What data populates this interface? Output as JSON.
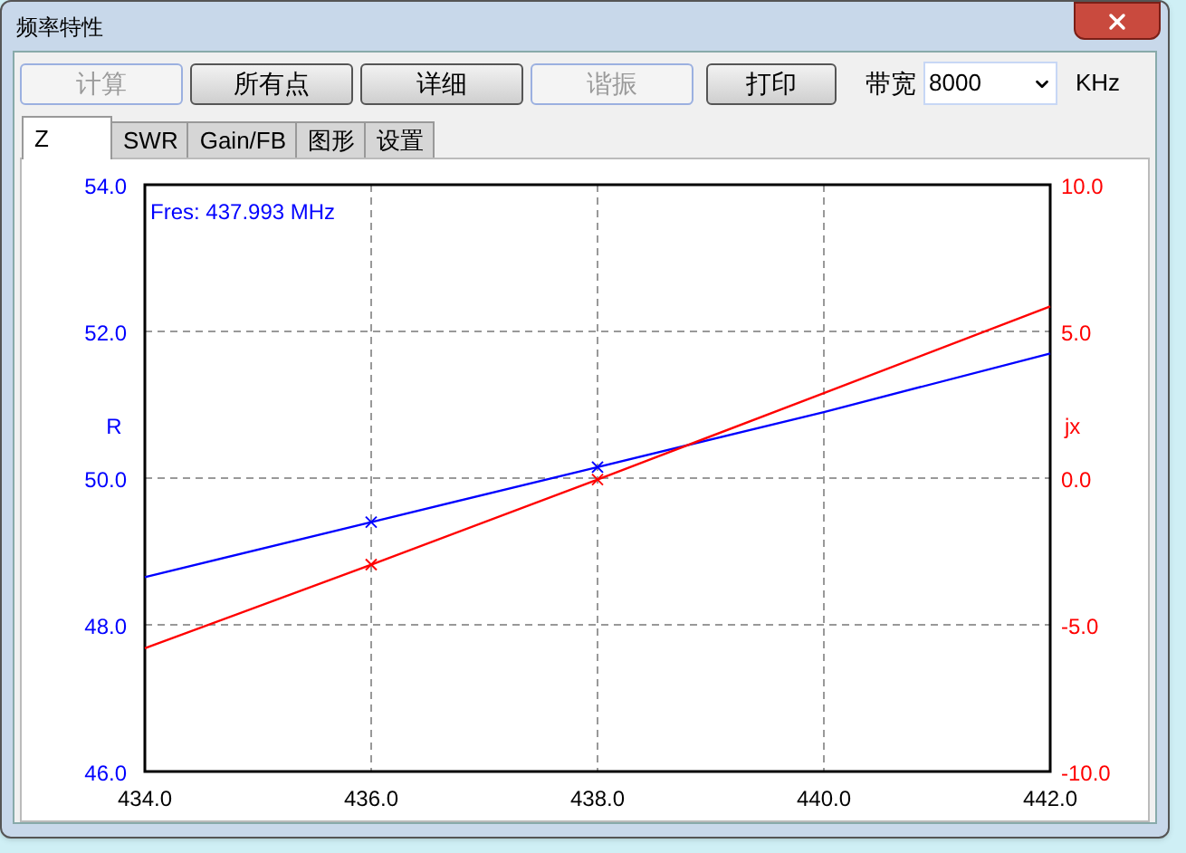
{
  "window": {
    "title": "频率特性"
  },
  "toolbar": {
    "buttons": [
      {
        "label": "计算",
        "disabled": true
      },
      {
        "label": "所有点",
        "disabled": false
      },
      {
        "label": "详细",
        "disabled": false
      },
      {
        "label": "谐振",
        "disabled": true
      },
      {
        "label": "打印",
        "disabled": false
      }
    ],
    "bandwidth": {
      "label": "带宽",
      "value": "8000",
      "unit": "KHz"
    }
  },
  "tabs": [
    {
      "label": "Z",
      "selected": true
    },
    {
      "label": "SWR",
      "selected": false
    },
    {
      "label": "Gain/FB",
      "selected": false
    },
    {
      "label": "图形",
      "selected": false
    },
    {
      "label": "设置",
      "selected": false
    }
  ],
  "chart": {
    "resonance_label": "Fres: 437.993 MHz",
    "point_markers": [
      {
        "marked": false
      },
      {
        "marked": true
      },
      {
        "marked": true
      },
      {
        "marked": false
      },
      {
        "marked": false
      }
    ],
    "chart_data": {
      "type": "line",
      "grid": true,
      "x": [
        434,
        436,
        438,
        440,
        442
      ],
      "xlim": [
        434,
        442
      ],
      "xticks": [
        {
          "value": 434,
          "label": "434.0"
        },
        {
          "value": 436,
          "label": "436.0"
        },
        {
          "value": 438,
          "label": "438.0"
        },
        {
          "value": 440,
          "label": "440.0"
        },
        {
          "value": 442,
          "label": "442.0"
        }
      ],
      "ylim": [
        46,
        54
      ],
      "yticks": [
        {
          "value": 46,
          "label": "46.0"
        },
        {
          "value": 48,
          "label": "48.0"
        },
        {
          "value": 50,
          "label": "50.0"
        },
        {
          "value": 52,
          "label": "52.0"
        },
        {
          "value": 54,
          "label": "54.0"
        }
      ],
      "y2lim": [
        -10,
        10
      ],
      "y2ticks": [
        {
          "value": -10,
          "label": "-10.0"
        },
        {
          "value": -5,
          "label": "-5.0"
        },
        {
          "value": 0,
          "label": "0.0"
        },
        {
          "value": 5,
          "label": "5.0"
        },
        {
          "value": 10,
          "label": "10.0"
        }
      ],
      "series": [
        {
          "name": "R",
          "color": "#0000ff",
          "values": [
            48.65,
            49.4,
            50.15,
            50.9,
            51.7
          ]
        },
        {
          "name": "jx",
          "color": "#ff0000",
          "axis": "y2",
          "values": [
            -5.8,
            -2.95,
            -0.05,
            2.9,
            5.85
          ]
        }
      ]
    }
  }
}
